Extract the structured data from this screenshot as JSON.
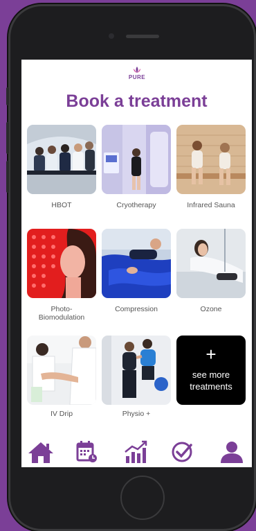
{
  "app": {
    "logo_text": "PURE",
    "title": "Book a treatment"
  },
  "treatments": [
    {
      "label": "HBOT"
    },
    {
      "label": "Cryotherapy"
    },
    {
      "label": "Infrared Sauna"
    },
    {
      "label": "Photo-\nBiomodulation"
    },
    {
      "label": "Compression"
    },
    {
      "label": "Ozone"
    },
    {
      "label": "IV Drip"
    },
    {
      "label": "Physio +"
    }
  ],
  "see_more": {
    "icon": "+",
    "label": "see more treatments"
  },
  "bottom_nav": [
    {
      "icon": "home-icon"
    },
    {
      "icon": "calendar-icon"
    },
    {
      "icon": "progress-chart-icon"
    },
    {
      "icon": "check-circle-icon"
    },
    {
      "icon": "profile-icon"
    }
  ],
  "colors": {
    "brand_purple": "#7b3f97",
    "tile_dark": "#000000"
  }
}
